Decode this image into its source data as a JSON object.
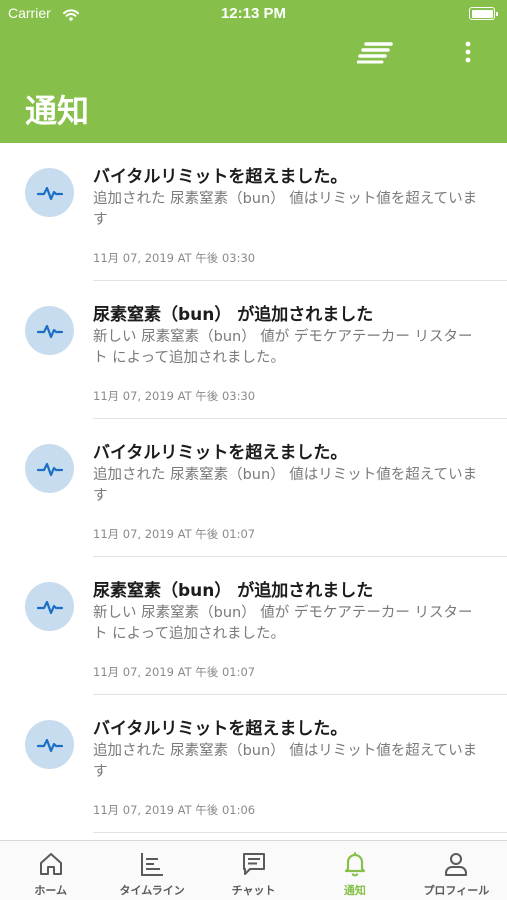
{
  "status_bar": {
    "carrier": "Carrier",
    "time": "12:13 PM"
  },
  "header": {
    "title": "通知"
  },
  "colors": {
    "brand": "#86c04a",
    "icon_bg": "#c8dcf0",
    "icon_fg": "#1a6fc4"
  },
  "notifications": [
    {
      "icon": "vital-pulse-icon",
      "title": "バイタルリミットを超えました。",
      "body": "追加された 尿素窒素（bun） 値はリミット値を超えています",
      "time": "11月 07, 2019 AT 午後 03:30"
    },
    {
      "icon": "vital-pulse-icon",
      "title": "尿素窒素（bun） が追加されました",
      "body": "新しい 尿素窒素（bun） 値が デモケアテーカー リスタート によって追加されました。",
      "time": "11月 07, 2019 AT 午後 03:30"
    },
    {
      "icon": "vital-pulse-icon",
      "title": "バイタルリミットを超えました。",
      "body": "追加された 尿素窒素（bun） 値はリミット値を超えています",
      "time": "11月 07, 2019 AT 午後 01:07"
    },
    {
      "icon": "vital-pulse-icon",
      "title": "尿素窒素（bun） が追加されました",
      "body": "新しい 尿素窒素（bun） 値が デモケアテーカー リスタート によって追加されました。",
      "time": "11月 07, 2019 AT 午後 01:07"
    },
    {
      "icon": "vital-pulse-icon",
      "title": "バイタルリミットを超えました。",
      "body": "追加された 尿素窒素（bun） 値はリミット値を超えています",
      "time": "11月 07, 2019 AT 午後 01:06"
    }
  ],
  "tabbar": {
    "tabs": [
      {
        "label": "ホーム",
        "icon": "home-icon",
        "active": false
      },
      {
        "label": "タイムライン",
        "icon": "timeline-icon",
        "active": false
      },
      {
        "label": "チャット",
        "icon": "chat-icon",
        "active": false
      },
      {
        "label": "通知",
        "icon": "bell-icon",
        "active": true
      },
      {
        "label": "プロフィール",
        "icon": "profile-icon",
        "active": false
      }
    ]
  }
}
